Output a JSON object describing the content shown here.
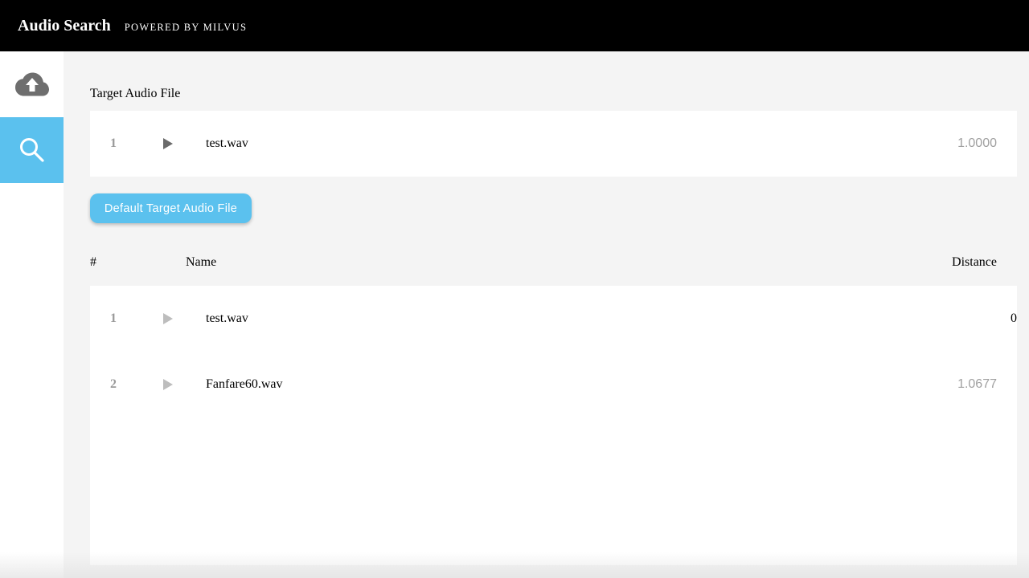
{
  "header": {
    "title": "Audio Search",
    "subtitle": "POWERED BY MILVUS"
  },
  "sidebar": {
    "items": [
      {
        "name": "upload",
        "icon": "cloud-upload-icon",
        "active": false
      },
      {
        "name": "search",
        "icon": "search-icon",
        "active": true
      }
    ]
  },
  "target": {
    "label": "Target Audio File",
    "file": {
      "index": "1",
      "name": "test.wav",
      "distance": "1.0000"
    }
  },
  "default_button": {
    "label": "Default Target Audio File"
  },
  "results": {
    "columns": {
      "index": "#",
      "name": "Name",
      "distance": "Distance"
    },
    "rows": [
      {
        "index": "1",
        "name": "test.wav",
        "distance": "0"
      },
      {
        "index": "2",
        "name": "Fanfare60.wav",
        "distance": "1.0677"
      }
    ]
  },
  "colors": {
    "accent": "#5bc1ee",
    "topbar": "#000000",
    "background": "#f4f4f4"
  }
}
